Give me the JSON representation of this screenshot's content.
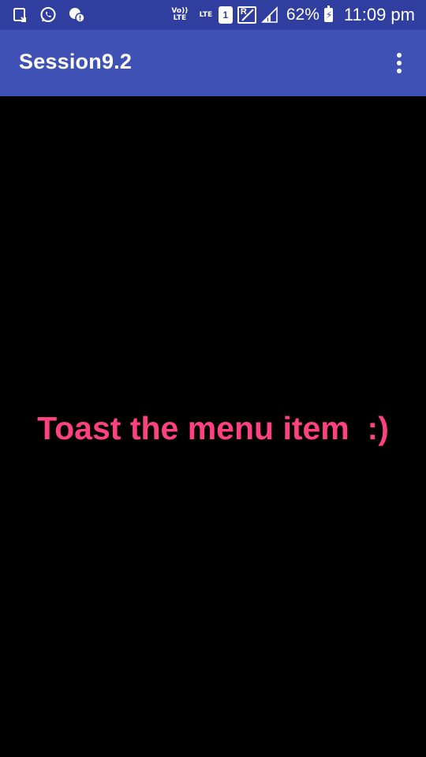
{
  "status_bar": {
    "volte_label": "Vo)) LTE",
    "lte_label": "LTE",
    "sim_number": "1",
    "roaming_label": "R",
    "battery_percent": "62%",
    "time": "11:09 pm",
    "icons": [
      "screenshot-icon",
      "whatsapp-icon",
      "chat-notification-icon",
      "volte-icon",
      "lte-icon",
      "sim-icon",
      "roaming-icon",
      "signal-icon",
      "battery-charging-icon"
    ],
    "background": "#303F9F"
  },
  "app_bar": {
    "title": "Session9.2",
    "background": "#3F51B5",
    "overflow_icon": "more-vert-icon"
  },
  "content": {
    "message": "Toast the menu item  :)",
    "message_color": "#FF4081",
    "background": "#000000"
  }
}
